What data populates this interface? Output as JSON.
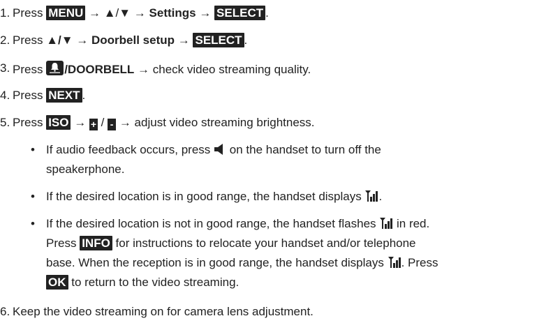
{
  "steps": [
    {
      "n": "1.",
      "a": "Press ",
      "k1": "MENU",
      "b": " → ▲/▼ → ",
      "c": "Settings",
      "d": " → ",
      "k2": "SELECT",
      "e": "."
    },
    {
      "n": "2.",
      "a": "Press ",
      "b": "▲/▼",
      "c": " → ",
      "d": "Doorbell setup",
      "e": " → ",
      "k1": "SELECT",
      "f": "."
    },
    {
      "n": "3.",
      "a": "Press ",
      "k1": "/DOORBELL",
      "b": " → check video streaming quality."
    },
    {
      "n": "4.",
      "a": "Press ",
      "k1": "NEXT",
      "b": "."
    },
    {
      "n": "5.",
      "a": "Press ",
      "k1": "ISO",
      "b": " → ",
      "k2": "+",
      "c": " / ",
      "k3": "-",
      "d": " → adjust video streaming brightness."
    },
    {
      "n": "6.",
      "a": "Keep the video streaming on for camera lens adjustment."
    }
  ],
  "bullets": {
    "b1_l1a": "If audio feedback occurs, press ",
    "b1_l1b": " on the handset to turn off the",
    "b1_l2": "speakerphone.",
    "b2_a": "If the desired location is in good range, the handset displays ",
    "b2_b": ".",
    "b3_l1a": "If the desired location is not in good range, the handset flashes ",
    "b3_l1b": " in red.",
    "b3_l2a": "Press ",
    "b3_l2k": "INFO",
    "b3_l2b": " for instructions to relocate your handset and/or telephone",
    "b3_l3a": "base. When the reception is in good range, the handset displays ",
    "b3_l3b": ". Press",
    "b3_l4k": "OK",
    "b3_l4b": " to return to the video streaming.",
    "dot": "•"
  },
  "icons": {
    "bell": "doorbell-icon",
    "speaker": "speaker-icon",
    "signal": "signal-strength-icon"
  },
  "colors": {
    "text": "#222222",
    "key_bg": "#222222",
    "key_fg": "#ffffff"
  }
}
